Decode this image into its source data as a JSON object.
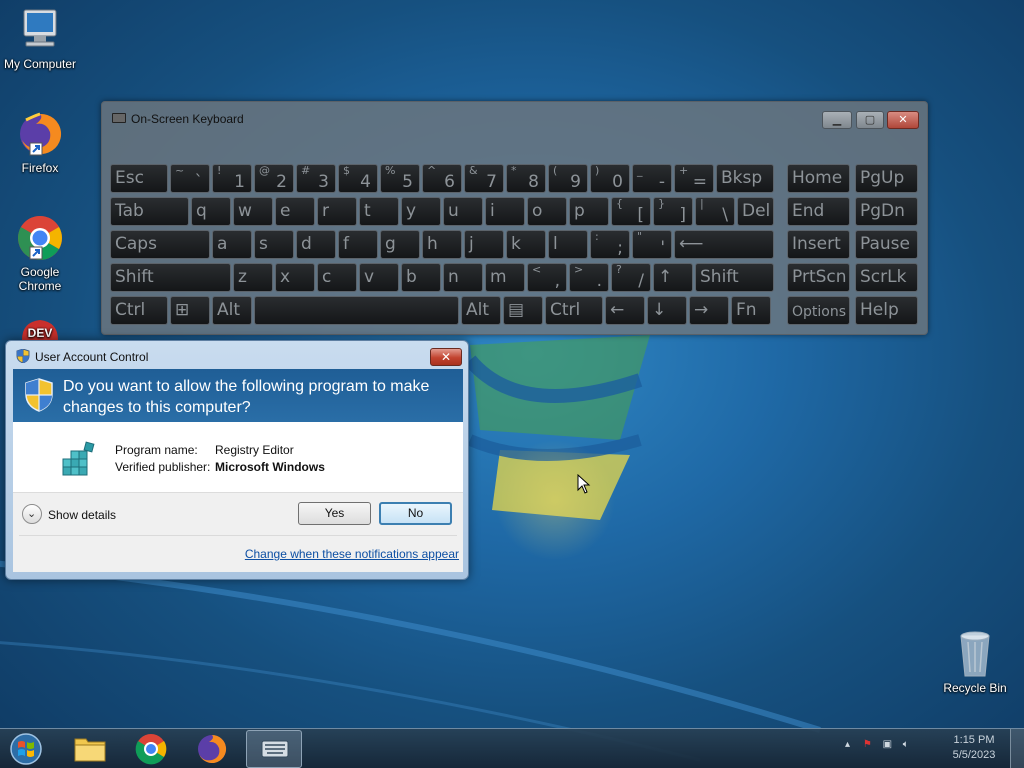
{
  "desktop": {
    "icons": [
      {
        "label": "My Computer",
        "icon": "computer-icon"
      },
      {
        "label": "Firefox",
        "icon": "firefox-icon"
      },
      {
        "label": "Google Chrome",
        "icon": "chrome-icon"
      },
      {
        "label": "DEV",
        "icon": "dev-icon"
      },
      {
        "label": "Recycle Bin",
        "icon": "recycle-bin-icon"
      }
    ]
  },
  "osk": {
    "title": "On-Screen Keyboard",
    "rows": [
      [
        {
          "label": "Esc"
        },
        {
          "top": "~",
          "label": "`"
        },
        {
          "top": "!",
          "label": "1"
        },
        {
          "top": "@",
          "label": "2"
        },
        {
          "top": "#",
          "label": "3"
        },
        {
          "top": "$",
          "label": "4"
        },
        {
          "top": "%",
          "label": "5"
        },
        {
          "top": "^",
          "label": "6"
        },
        {
          "top": "&",
          "label": "7"
        },
        {
          "top": "*",
          "label": "8"
        },
        {
          "top": "(",
          "label": "9"
        },
        {
          "top": ")",
          "label": "0"
        },
        {
          "top": "_",
          "label": "-"
        },
        {
          "top": "+",
          "label": "="
        },
        {
          "label": "Bksp"
        },
        {
          "label": "Home"
        },
        {
          "label": "PgUp"
        }
      ],
      [
        {
          "label": "Tab"
        },
        {
          "label": "q"
        },
        {
          "label": "w"
        },
        {
          "label": "e"
        },
        {
          "label": "r"
        },
        {
          "label": "t"
        },
        {
          "label": "y"
        },
        {
          "label": "u"
        },
        {
          "label": "i"
        },
        {
          "label": "o"
        },
        {
          "label": "p"
        },
        {
          "top": "{",
          "label": "["
        },
        {
          "top": "}",
          "label": "]"
        },
        {
          "top": "|",
          "label": "\\"
        },
        {
          "label": "Del"
        },
        {
          "label": "End"
        },
        {
          "label": "PgDn"
        }
      ],
      [
        {
          "label": "Caps"
        },
        {
          "label": "a"
        },
        {
          "label": "s"
        },
        {
          "label": "d"
        },
        {
          "label": "f"
        },
        {
          "label": "g"
        },
        {
          "label": "h"
        },
        {
          "label": "j"
        },
        {
          "label": "k"
        },
        {
          "label": "l"
        },
        {
          "top": ":",
          "label": ";"
        },
        {
          "top": "\"",
          "label": "'"
        },
        {
          "label": "⟵"
        },
        {
          "label": "Insert"
        },
        {
          "label": "Pause"
        }
      ],
      [
        {
          "label": "Shift"
        },
        {
          "label": "z"
        },
        {
          "label": "x"
        },
        {
          "label": "c"
        },
        {
          "label": "v"
        },
        {
          "label": "b"
        },
        {
          "label": "n"
        },
        {
          "label": "m"
        },
        {
          "top": "<",
          "label": ","
        },
        {
          "top": ">",
          "label": "."
        },
        {
          "top": "?",
          "label": "/"
        },
        {
          "label": "↑"
        },
        {
          "label": "Shift"
        },
        {
          "label": "PrtScn"
        },
        {
          "label": "ScrLk"
        }
      ],
      [
        {
          "label": "Ctrl"
        },
        {
          "label": "⊞"
        },
        {
          "label": "Alt"
        },
        {
          "label": ""
        },
        {
          "label": "Alt"
        },
        {
          "label": "▤"
        },
        {
          "label": "Ctrl"
        },
        {
          "label": "←"
        },
        {
          "label": "↓"
        },
        {
          "label": "→"
        },
        {
          "label": "Fn"
        },
        {
          "label": "Options"
        },
        {
          "label": "Help"
        }
      ]
    ]
  },
  "uac": {
    "title": "User Account Control",
    "question": "Do you want to allow the following program to make changes to this computer?",
    "program_name_label": "Program name:",
    "program_name": "Registry Editor",
    "publisher_label": "Verified publisher:",
    "publisher": "Microsoft Windows",
    "show_details": "Show details",
    "yes": "Yes",
    "no": "No",
    "notifications_link": "Change when these notifications appear"
  },
  "taskbar": {
    "items": [
      "start-orb-icon",
      "file-explorer-icon",
      "chrome-icon",
      "firefox-icon",
      "on-screen-keyboard-icon"
    ],
    "active_item": "on-screen-keyboard-icon",
    "time": "1:15 PM",
    "date": "5/5/2023"
  }
}
